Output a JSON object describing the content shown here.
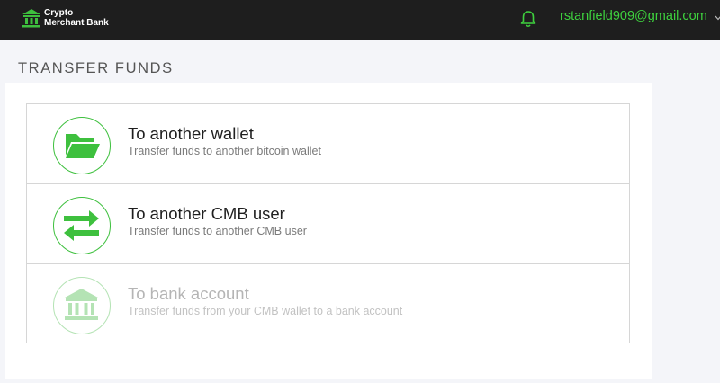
{
  "header": {
    "logo_line1": "Crypto",
    "logo_line2": "Merchant Bank",
    "user_email": "rstanfield909@gmail.com",
    "icons": {
      "logo": "bank-building-icon",
      "notifications": "bell-icon",
      "user_menu": "chevron-down-icon"
    }
  },
  "page": {
    "title": "TRANSFER FUNDS"
  },
  "options": [
    {
      "title": "To another wallet",
      "description": "Transfer funds to another bitcoin wallet",
      "icon": "open-folder-icon",
      "enabled": true
    },
    {
      "title": "To another CMB user",
      "description": "Transfer funds to another CMB user",
      "icon": "transfer-arrows-icon",
      "enabled": true
    },
    {
      "title": "To bank account",
      "description": "Transfer funds from your CMB wallet to a bank account",
      "icon": "bank-icon",
      "enabled": false
    }
  ],
  "colors": {
    "accent": "#3ec03e",
    "accent_light": "#b4e3b4",
    "topbar": "#1e1e1e",
    "background": "#f4f5f9"
  }
}
